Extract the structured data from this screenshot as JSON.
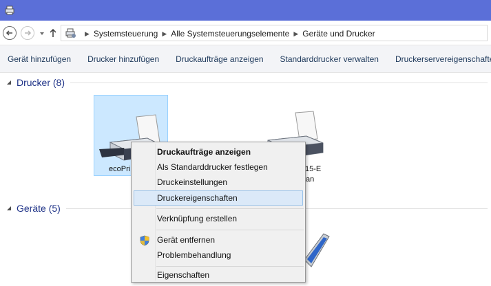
{
  "titlebar": {
    "icon": "devices-printers-icon",
    "accent": "#5b6fd8"
  },
  "nav": {
    "back_icon": "back-arrow-icon",
    "forward_icon": "forward-arrow-icon",
    "recent_icon": "chevron-down-icon",
    "up_icon": "up-arrow-icon"
  },
  "breadcrumb": {
    "icon": "devices-printers-icon",
    "items": [
      "Systemsteuerung",
      "Alle Systemsteuerungselemente",
      "Geräte und Drucker"
    ]
  },
  "toolbar": {
    "items": [
      "Gerät hinzufügen",
      "Drucker hinzufügen",
      "Druckaufträge anzeigen",
      "Standarddrucker verwalten",
      "Druckerservereigenschaften"
    ]
  },
  "groups": {
    "printers": {
      "title": "Drucker (8)"
    },
    "devices": {
      "title": "Geräte (5)"
    }
  },
  "printers": [
    {
      "label": "ecoPri",
      "icon": "printer-icon",
      "selected": true
    },
    {
      "label_line1": "15-E",
      "label_line2": "an",
      "icon": "printer-icon",
      "selected": false
    }
  ],
  "devices": [
    {
      "icon": "laptop-icon"
    }
  ],
  "context_menu": {
    "items": [
      {
        "label": "Druckaufträge anzeigen",
        "bold": true
      },
      {
        "label": "Als Standarddrucker festlegen"
      },
      {
        "label": "Druckeinstellungen"
      },
      {
        "label": "Druckereigenschaften",
        "highlighted": true
      },
      {
        "label": "Verknüpfung erstellen"
      },
      {
        "label": "Gerät entfernen",
        "icon": "uac-shield-icon"
      },
      {
        "label": "Problembehandlung"
      },
      {
        "label": "Eigenschaften"
      }
    ]
  },
  "colors": {
    "selection": "#cce8ff",
    "menu_highlight": "#dbe9f8",
    "group_title": "#1e3287",
    "toolbar_text": "#1e395b"
  }
}
